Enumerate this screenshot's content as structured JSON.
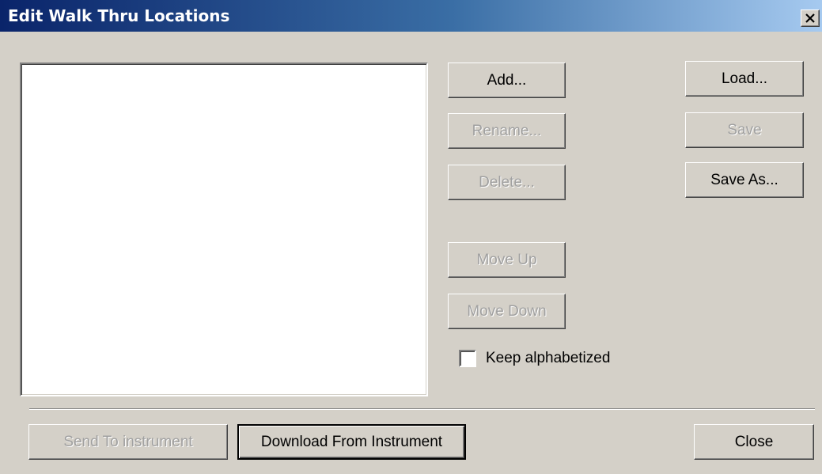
{
  "window": {
    "title": "Edit Walk Thru Locations",
    "close_glyph": "×"
  },
  "list": {
    "items": []
  },
  "buttons": {
    "add": "Add...",
    "rename": "Rename...",
    "delete": "Delete...",
    "move_up": "Move Up",
    "move_down": "Move Down",
    "load": "Load...",
    "save": "Save",
    "save_as": "Save As...",
    "send_to_instrument": "Send To instrument",
    "download_from_instrument": "Download From Instrument",
    "close": "Close"
  },
  "checkbox": {
    "keep_alphabetized_label": "Keep alphabetized",
    "keep_alphabetized_checked": false
  },
  "icons": {
    "close": "close-icon"
  },
  "colors": {
    "titlebar_start": "#0a246a",
    "titlebar_end": "#a6caf0",
    "dialog_background": "#d4d0c8",
    "disabled_text": "#a0a0a0"
  }
}
